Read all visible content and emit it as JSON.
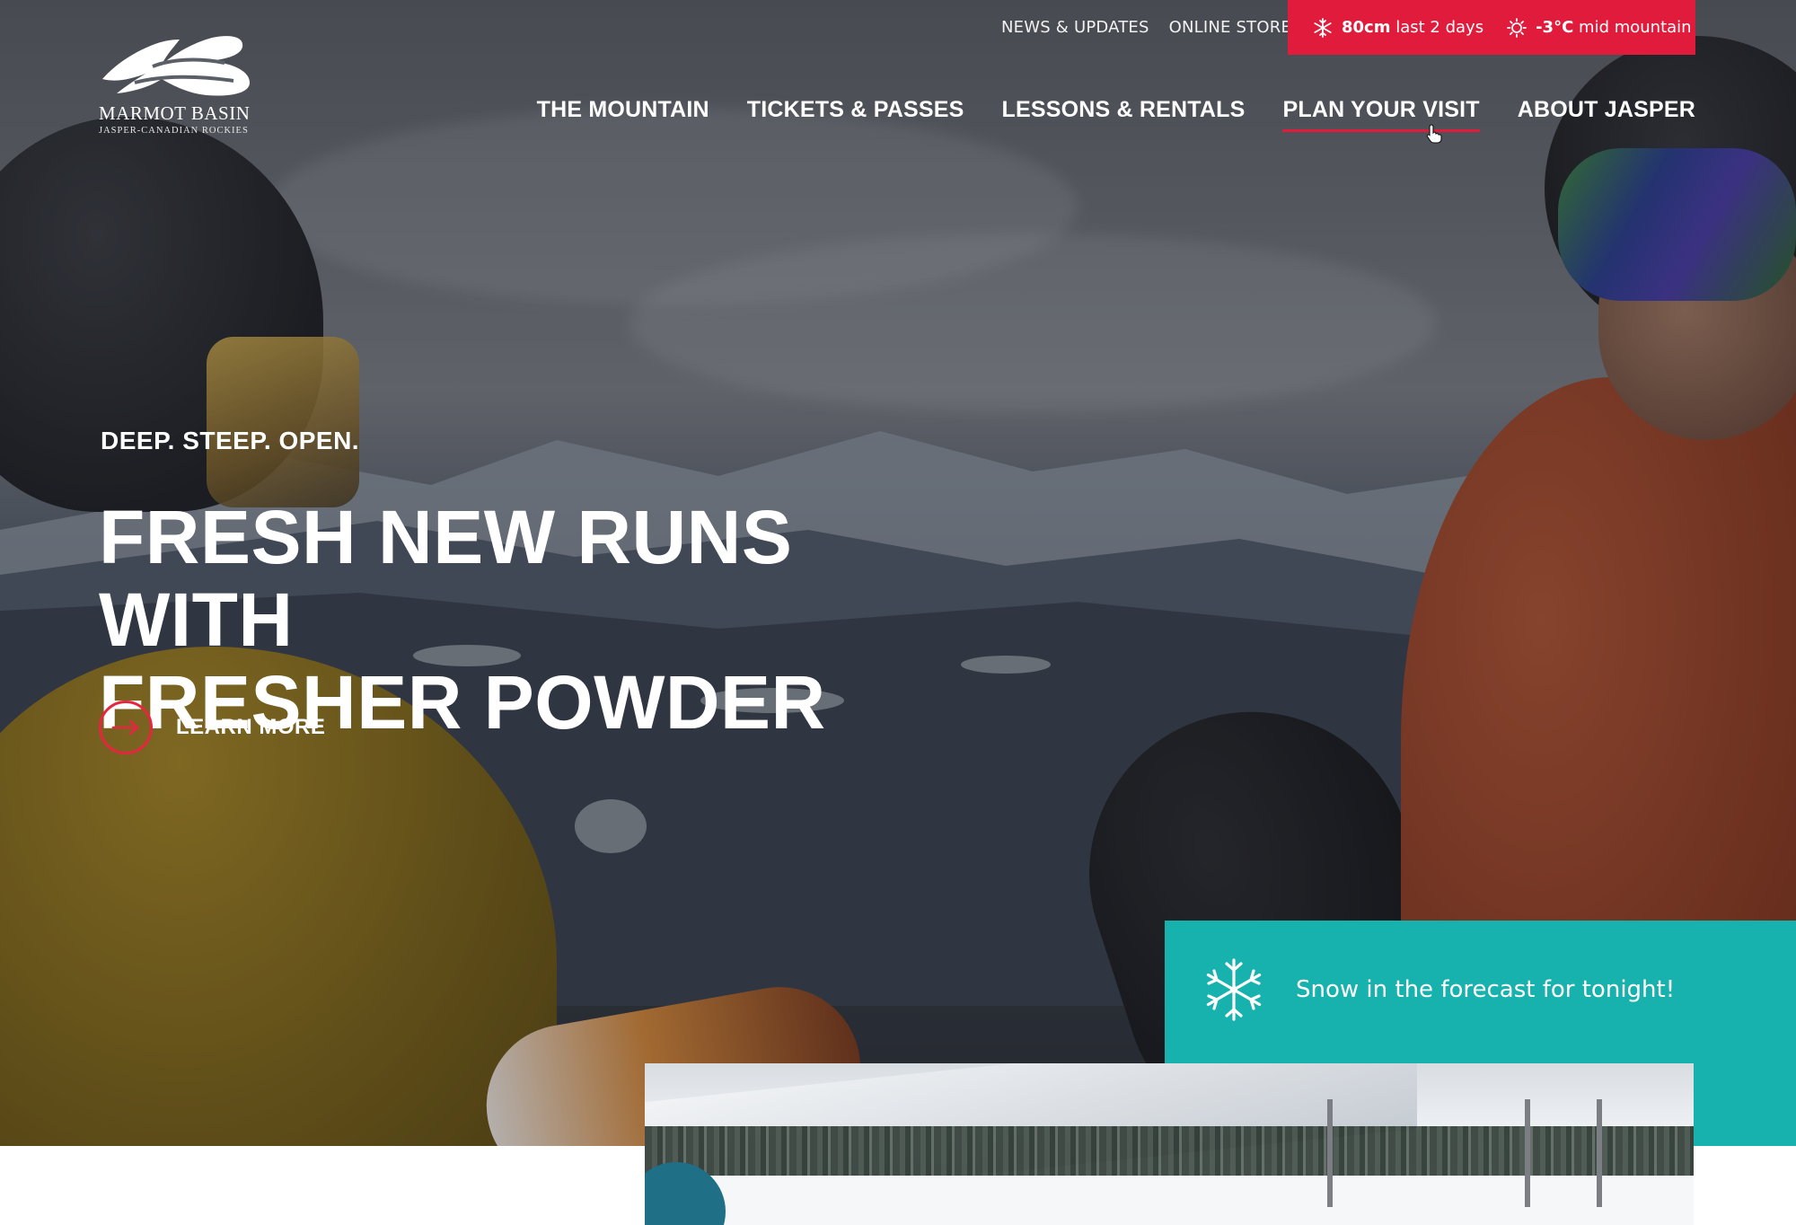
{
  "brand": {
    "name": "MARMOT BASIN",
    "tagline": "JASPER-CANADIAN ROCKIES"
  },
  "utility_nav": [
    {
      "label": "NEWS & UPDATES"
    },
    {
      "label": "ONLINE STORE"
    }
  ],
  "conditions": {
    "snow_value": "80cm",
    "snow_label": "last 2 days",
    "snow_icon": "snowflake-icon",
    "temp_value": "-3°C",
    "temp_label": "mid mountain",
    "temp_icon": "sun-icon",
    "bg_color": "#e11b3c"
  },
  "main_nav": [
    {
      "label": "THE MOUNTAIN",
      "active": false
    },
    {
      "label": "TICKETS & PASSES",
      "active": false
    },
    {
      "label": "LESSONS & RENTALS",
      "active": false
    },
    {
      "label": "PLAN YOUR VISIT",
      "active": true
    },
    {
      "label": "ABOUT JASPER",
      "active": false
    }
  ],
  "hero": {
    "eyebrow": "DEEP. STEEP. OPEN.",
    "headline_line1": "FRESH NEW RUNS WITH",
    "headline_line2": "FRESHER POWDER",
    "cta_label": "LEARN MORE",
    "cta_icon": "arrow-right-icon",
    "accent_color": "#e6263f"
  },
  "forecast": {
    "icon": "snowflake-icon",
    "text": "Snow in the forecast for tonight!",
    "bg_color": "#18b2ae"
  }
}
